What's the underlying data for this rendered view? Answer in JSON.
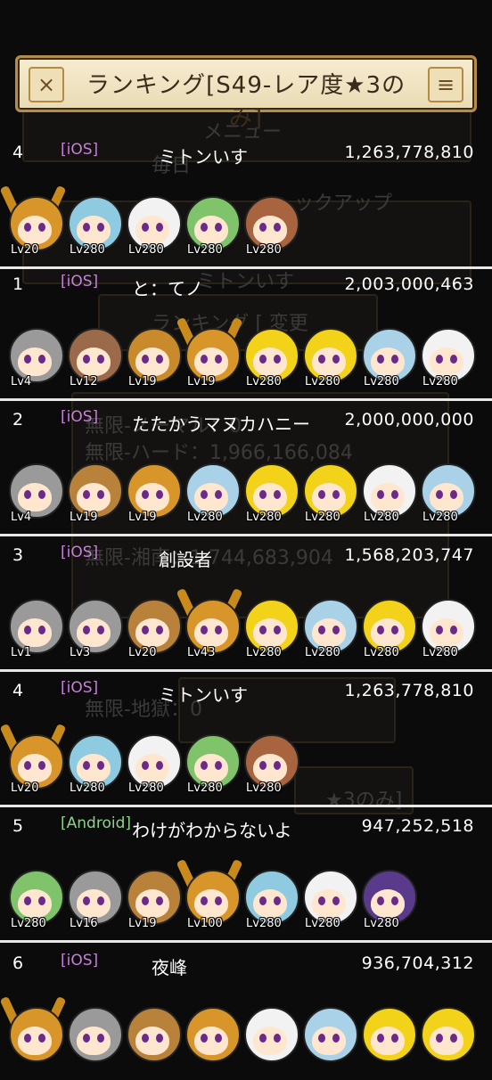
{
  "header": {
    "title": "ランキング[S49-レア度★3のみ]",
    "close_icon": "×",
    "menu_icon": "≡"
  },
  "background": {
    "texts": [
      "メニュー",
      "毎日",
      "ックアップ",
      "ミトンいす",
      "ランキング [ 変更",
      "無限-ノーマル：0",
      "無限-ハード：1,966,166,084",
      "無限-湘南：1,744,683,904",
      "無限-地獄：0",
      "★3のみ]"
    ]
  },
  "rows": [
    {
      "rank": "4",
      "platform": "[iOS]",
      "platform_color": "#c77fd9",
      "name": "ミトンいす",
      "score": "1,263,778,810",
      "chars": [
        {
          "lv": "Lv20",
          "hair": "#d8962a",
          "antler": true
        },
        {
          "lv": "Lv280",
          "hair": "#8ecbe0"
        },
        {
          "lv": "Lv280",
          "hair": "#f2f2f2"
        },
        {
          "lv": "Lv280",
          "hair": "#7fc46a"
        },
        {
          "lv": "Lv280",
          "hair": "#a8643e"
        }
      ]
    },
    {
      "rank": "1",
      "platform": "[iOS]",
      "platform_color": "#c77fd9",
      "name": "と：てノ",
      "score": "2,003,000,463",
      "chars": [
        {
          "lv": "Lv4",
          "hair": "#9a9a9a"
        },
        {
          "lv": "Lv12",
          "hair": "#9a6a4a"
        },
        {
          "lv": "Lv19",
          "hair": "#c88a2a"
        },
        {
          "lv": "Lv19",
          "hair": "#d8962a",
          "antler": true
        },
        {
          "lv": "Lv280",
          "hair": "#f3d21a"
        },
        {
          "lv": "Lv280",
          "hair": "#f3d21a"
        },
        {
          "lv": "Lv280",
          "hair": "#a9d2e8"
        },
        {
          "lv": "Lv280",
          "hair": "#f2f2f2"
        }
      ]
    },
    {
      "rank": "2",
      "platform": "[iOS]",
      "platform_color": "#c77fd9",
      "name": "たたかうマヌカハニー",
      "score": "2,000,000,000",
      "chars": [
        {
          "lv": "Lv4",
          "hair": "#9a9a9a"
        },
        {
          "lv": "Lv19",
          "hair": "#b8823a"
        },
        {
          "lv": "Lv19",
          "hair": "#d8962a"
        },
        {
          "lv": "Lv280",
          "hair": "#a9d2e8"
        },
        {
          "lv": "Lv280",
          "hair": "#f3d21a"
        },
        {
          "lv": "Lv280",
          "hair": "#f3d21a"
        },
        {
          "lv": "Lv280",
          "hair": "#f2f2f2"
        },
        {
          "lv": "Lv280",
          "hair": "#a9d2e8"
        }
      ]
    },
    {
      "rank": "3",
      "platform": "[iOS]",
      "platform_color": "#c77fd9",
      "name": "創設者",
      "score": "1,568,203,747",
      "chars": [
        {
          "lv": "Lv1",
          "hair": "#9a9a9a"
        },
        {
          "lv": "Lv3",
          "hair": "#9a9a9a"
        },
        {
          "lv": "Lv20",
          "hair": "#b8823a"
        },
        {
          "lv": "Lv43",
          "hair": "#d8962a",
          "antler": true
        },
        {
          "lv": "Lv280",
          "hair": "#f3d21a"
        },
        {
          "lv": "Lv280",
          "hair": "#a9d2e8"
        },
        {
          "lv": "Lv280",
          "hair": "#f3d21a"
        },
        {
          "lv": "Lv280",
          "hair": "#f2f2f2"
        }
      ]
    },
    {
      "rank": "4",
      "platform": "[iOS]",
      "platform_color": "#c77fd9",
      "name": "ミトンいす",
      "score": "1,263,778,810",
      "chars": [
        {
          "lv": "Lv20",
          "hair": "#d8962a",
          "antler": true
        },
        {
          "lv": "Lv280",
          "hair": "#8ecbe0"
        },
        {
          "lv": "Lv280",
          "hair": "#f2f2f2"
        },
        {
          "lv": "Lv280",
          "hair": "#7fc46a"
        },
        {
          "lv": "Lv280",
          "hair": "#a8643e"
        }
      ]
    },
    {
      "rank": "5",
      "platform": "[Android]",
      "platform_color": "#8fd18a",
      "name": "わけがわからないよ",
      "score": "947,252,518",
      "chars": [
        {
          "lv": "Lv280",
          "hair": "#7fc46a"
        },
        {
          "lv": "Lv16",
          "hair": "#9a9a9a"
        },
        {
          "lv": "Lv19",
          "hair": "#b8823a"
        },
        {
          "lv": "Lv100",
          "hair": "#d8962a",
          "antler": true
        },
        {
          "lv": "Lv280",
          "hair": "#8ecbe0"
        },
        {
          "lv": "Lv280",
          "hair": "#f2f2f2"
        },
        {
          "lv": "Lv280",
          "hair": "#5a3a8a"
        }
      ]
    },
    {
      "rank": "6",
      "platform": "[iOS]",
      "platform_color": "#c77fd9",
      "name": "夜峰",
      "score": "936,704,312",
      "chars": [
        {
          "lv": "",
          "hair": "#d8962a",
          "antler": true
        },
        {
          "lv": "",
          "hair": "#9a9a9a"
        },
        {
          "lv": "",
          "hair": "#b8823a"
        },
        {
          "lv": "",
          "hair": "#d8962a"
        },
        {
          "lv": "",
          "hair": "#f2f2f2"
        },
        {
          "lv": "",
          "hair": "#a9d2e8"
        },
        {
          "lv": "",
          "hair": "#f3d21a"
        },
        {
          "lv": "",
          "hair": "#f3d21a"
        }
      ]
    }
  ]
}
